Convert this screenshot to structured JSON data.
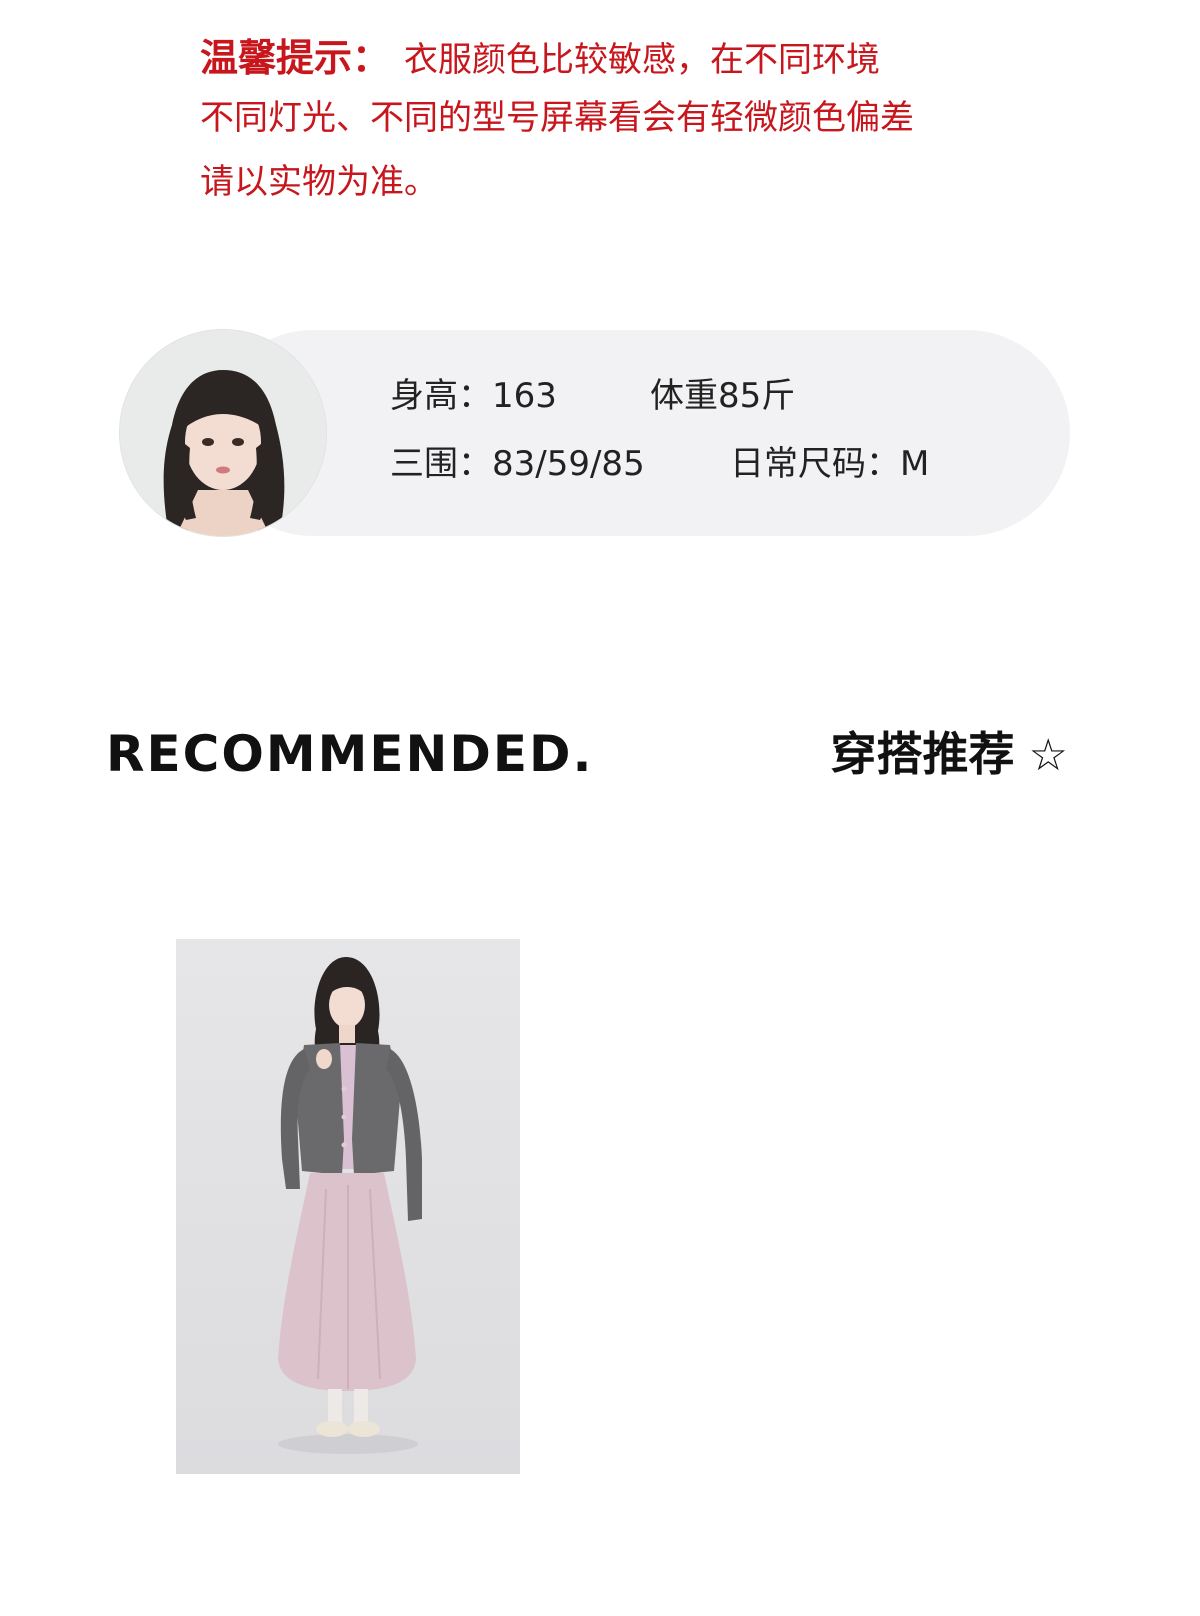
{
  "notice": {
    "title": "温馨提示：",
    "line1": "衣服颜色比较敏感，在不同环境",
    "line2": "不同灯光、不同的型号屏幕看会有轻微颜色偏差",
    "line3": "请以实物为准。",
    "color": "#c8161d"
  },
  "model": {
    "height": "身高：163",
    "weight": "体重85斤",
    "measurements": "三围：83/59/85",
    "size": "日常尺码：M",
    "card_color": "#f2f2f4"
  },
  "recommend": {
    "title_en": "RECOMMENDED.",
    "title_cn": "穿搭推荐",
    "star": "☆"
  },
  "outfit": {
    "top_color": "#6a6a6d",
    "inner_color": "#d9c1d3",
    "skirt_color": "#dcc3cb",
    "shoe_color": "#ece4d6"
  }
}
